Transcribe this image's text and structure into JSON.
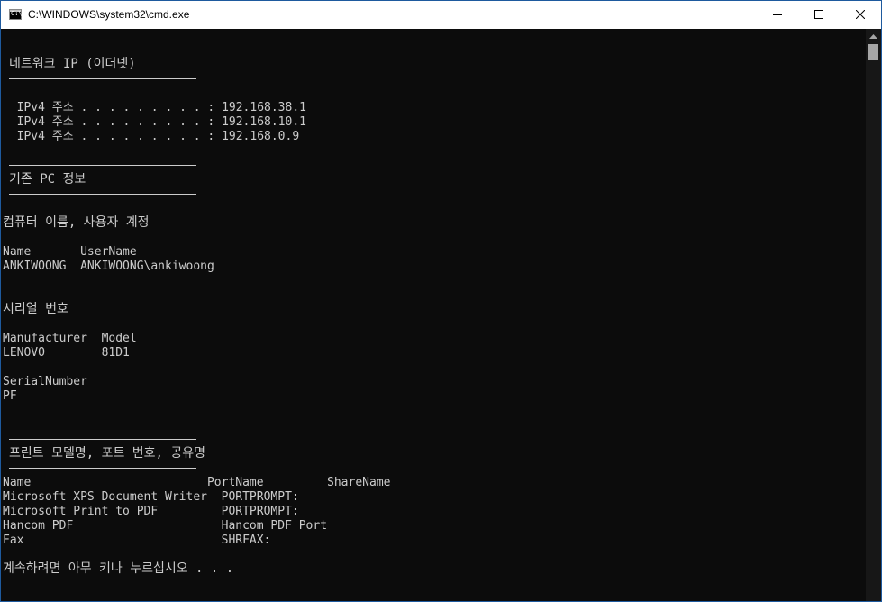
{
  "window": {
    "title": "C:\\WINDOWS\\system32\\cmd.exe",
    "icon": "cmd-icon",
    "icon_prompt": "C:\\",
    "controls": [
      "minimize-icon",
      "maximize-icon",
      "close-icon"
    ]
  },
  "colors": {
    "console_bg": "#0c0c0c",
    "console_text": "#cccccc",
    "titlebar_bg": "#ffffff"
  },
  "network": {
    "heading": "네트워크 IP (이더넷)",
    "lines": [
      "  IPv4 주소 . . . . . . . . . : 192.168.38.1",
      "  IPv4 주소 . . . . . . . . . : 192.168.10.1",
      "  IPv4 주소 . . . . . . . . . : 192.168.0.9"
    ]
  },
  "pc_info": {
    "heading": "기존 PC 정보",
    "computer_section": "컴퓨터 이름, 사용자 계정",
    "computer_header": "Name       UserName",
    "computer_row": "ANKIWOONG  ANKIWOONG\\ankiwoong",
    "serial_section": "시리얼 번호",
    "maker_header": "Manufacturer  Model",
    "maker_row": "LENOVO        81D1",
    "serial_header": "SerialNumber",
    "serial_row": "PF"
  },
  "printers": {
    "heading": "프린트 모델명, 포트 번호, 공유명",
    "header": "Name                         PortName         ShareName",
    "rows": [
      "Microsoft XPS Document Writer  PORTPROMPT:",
      "Microsoft Print to PDF         PORTPROMPT:",
      "Hancom PDF                     Hancom PDF Port",
      "Fax                            SHRFAX:"
    ]
  },
  "prompt": "계속하려면 아무 키나 누르십시오 . . ."
}
